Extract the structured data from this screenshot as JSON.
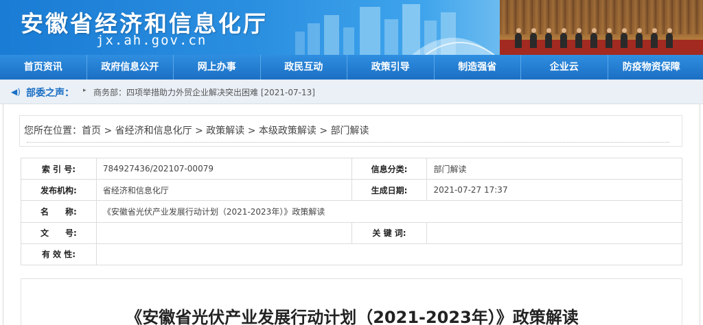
{
  "header": {
    "site_title": "安徽省经济和信息化厅",
    "site_domain": "jx.ah.gov.cn"
  },
  "nav": {
    "items": [
      {
        "label": "首页资讯"
      },
      {
        "label": "政府信息公开"
      },
      {
        "label": "网上办事"
      },
      {
        "label": "政民互动"
      },
      {
        "label": "政策引导"
      },
      {
        "label": "制造强省"
      },
      {
        "label": "企业云"
      },
      {
        "label": "防疫物资保障"
      }
    ]
  },
  "ticker": {
    "label": "部委之声：",
    "news": "商务部：四项举措助力外贸企业解决突出困难 [2021-07-13]"
  },
  "breadcrumb": {
    "prefix": "您所在位置：",
    "items": [
      "首页",
      "省经济和信息化厅",
      "政策解读",
      "本级政策解读",
      "部门解读"
    ],
    "separator": " > "
  },
  "info": {
    "index_label": "索 引 号:",
    "index_value": "784927436/202107-00079",
    "category_label": "信息分类:",
    "category_value": "部门解读",
    "publisher_label": "发布机构:",
    "publisher_value": "省经济和信息化厅",
    "date_label": "生成日期:",
    "date_value": "2021-07-27 17:37",
    "name_label": "名　　称:",
    "name_value": "《安徽省光伏产业发展行动计划（2021-2023年）》政策解读",
    "docno_label": "文　　号:",
    "docno_value": "",
    "keywords_label": "关 键 词:",
    "keywords_value": "",
    "validity_label": "有 效 性:",
    "validity_value": ""
  },
  "article": {
    "title": "《安徽省光伏产业发展行动计划（2021-2023年）》政策解读"
  },
  "colors": {
    "brand_blue": "#1b6fc4",
    "nav_top": "#2f8ee0",
    "ticker_bg": "#eaf0f6"
  }
}
